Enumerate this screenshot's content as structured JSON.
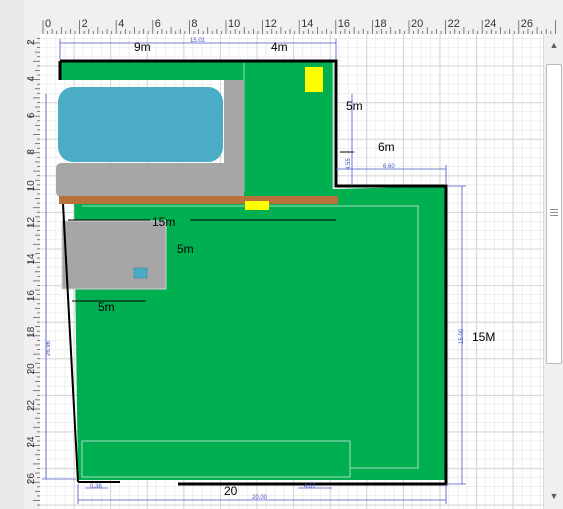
{
  "rulers": {
    "top_labels": [
      "0",
      "2",
      "4",
      "6",
      "8",
      "10",
      "12",
      "14",
      "16",
      "18",
      "20",
      "22",
      "24",
      "26"
    ],
    "left_labels": [
      "2",
      "4",
      "6",
      "8",
      "10",
      "12",
      "14",
      "16",
      "18",
      "20",
      "22",
      "24",
      "26"
    ]
  },
  "labels": {
    "top_left": "9m",
    "top_right": "4m",
    "right_upper": "5m",
    "step": "6m",
    "mid_width": "15m",
    "block_height": "5m",
    "block_width": "5m",
    "right_side": "15M",
    "bottom": "20"
  },
  "dimension_labels": {
    "top_overall": "15.01",
    "step": "6.60",
    "upper_height": "4.55",
    "right_height": "15.00",
    "left_height": "26.96",
    "bottom_left": "0.36",
    "bottom_right": "4.67",
    "bottom_total": "20.00"
  },
  "scrollbar": {
    "up_icon": "triangle-up",
    "down_icon": "triangle-down"
  },
  "colors": {
    "lawn": "#00b050",
    "pool": "#4bacc6",
    "paving": "#a6a6a6",
    "fence": "#b8723c",
    "marker": "#ffff00",
    "dimension": "#4a55c8",
    "boundary": "#000000"
  }
}
